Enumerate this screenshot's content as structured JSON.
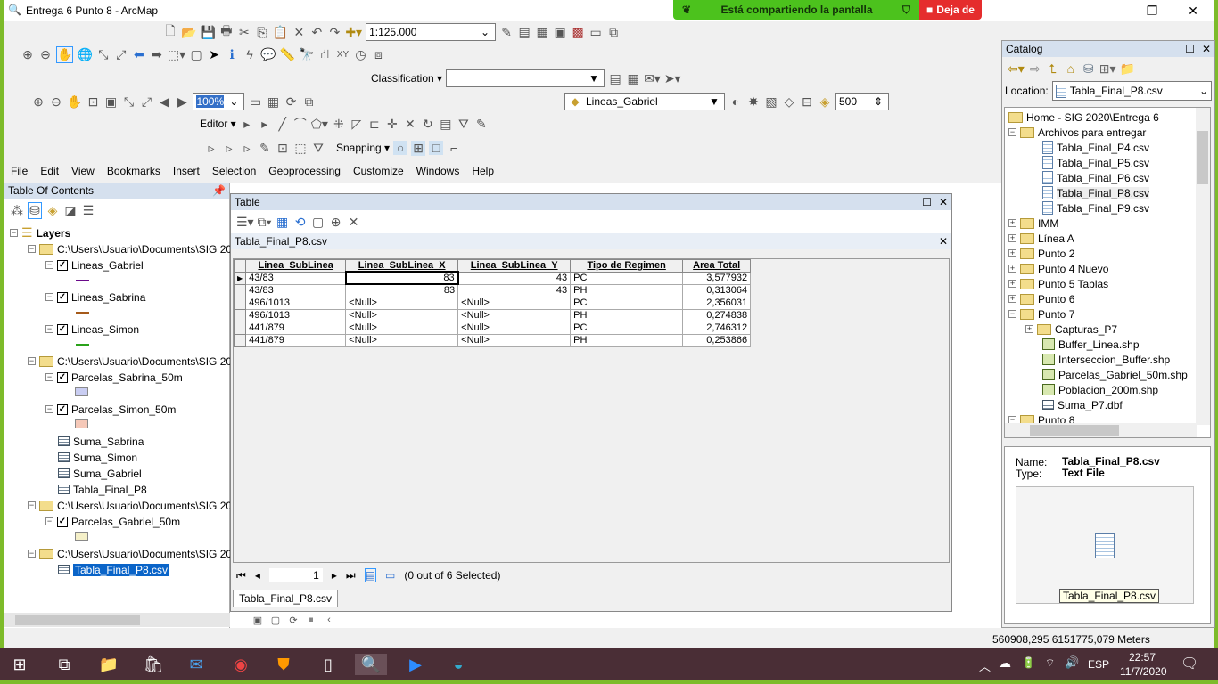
{
  "window": {
    "title": "Entrega 6 Punto 8 - ArcMap",
    "minimize": "–",
    "restore": "❐",
    "close": "✕"
  },
  "screenshare": {
    "text": "Está compartiendo la pantalla",
    "stop": "Deja de"
  },
  "toolbar": {
    "scale": "1:125.000",
    "classification": "Classification ▾",
    "zoom_pct": "100%",
    "layer": "Lineas_Gabriel",
    "ref_scale": "500",
    "editor": "Editor ▾",
    "snapping": "Snapping ▾"
  },
  "menu": [
    "File",
    "Edit",
    "View",
    "Bookmarks",
    "Insert",
    "Selection",
    "Geoprocessing",
    "Customize",
    "Windows",
    "Help"
  ],
  "toc": {
    "title": "Table Of Contents",
    "root": "Layers",
    "items": [
      {
        "type": "folder",
        "label": "C:\\Users\\Usuario\\Documents\\SIG 20"
      },
      {
        "type": "layer",
        "label": "Lineas_Gabriel",
        "color": "#6a0a8a",
        "sym": "line"
      },
      {
        "type": "layer",
        "label": "Lineas_Sabrina",
        "color": "#a55a1a",
        "sym": "line"
      },
      {
        "type": "layer",
        "label": "Lineas_Simon",
        "color": "#2aa21a",
        "sym": "line"
      },
      {
        "type": "folder",
        "label": "C:\\Users\\Usuario\\Documents\\SIG 20"
      },
      {
        "type": "layer",
        "label": "Parcelas_Sabrina_50m",
        "color": "#c9cdf2",
        "sym": "fill"
      },
      {
        "type": "layer",
        "label": "Parcelas_Simon_50m",
        "color": "#f5c8b8",
        "sym": "fill"
      },
      {
        "type": "table",
        "label": "Suma_Sabrina"
      },
      {
        "type": "table",
        "label": "Suma_Simon"
      },
      {
        "type": "table",
        "label": "Suma_Gabriel"
      },
      {
        "type": "table",
        "label": "Tabla_Final_P8"
      },
      {
        "type": "folder",
        "label": "C:\\Users\\Usuario\\Documents\\SIG 20"
      },
      {
        "type": "layer",
        "label": "Parcelas_Gabriel_50m",
        "color": "#f5f0c8",
        "sym": "fill"
      },
      {
        "type": "folder",
        "label": "C:\\Users\\Usuario\\Documents\\SIG 20"
      },
      {
        "type": "table",
        "label": "Tabla_Final_P8.csv",
        "selected": true
      }
    ]
  },
  "table": {
    "title": "Table",
    "tab_name": "Tabla_Final_P8.csv",
    "columns": [
      "Linea_SubLinea",
      "Linea_SubLinea_X",
      "Linea_SubLinea_Y",
      "Tipo de Regimen",
      "Area Total"
    ],
    "rows": [
      [
        "43/83",
        "83",
        "43",
        "PC",
        "3,577932"
      ],
      [
        "43/83",
        "83",
        "43",
        "PH",
        "0,313064"
      ],
      [
        "496/1013",
        "<Null>",
        "<Null>",
        "PC",
        "2,356031"
      ],
      [
        "496/1013",
        "<Null>",
        "<Null>",
        "PH",
        "0,274838"
      ],
      [
        "441/879",
        "<Null>",
        "<Null>",
        "PC",
        "2,746312"
      ],
      [
        "441/879",
        "<Null>",
        "<Null>",
        "PH",
        "0,253866"
      ]
    ],
    "record": "1",
    "selection": "(0 out of 6 Selected)",
    "bottom_tab": "Tabla_Final_P8.csv"
  },
  "catalog": {
    "title": "Catalog",
    "location_label": "Location:",
    "location": "Tabla_Final_P8.csv",
    "items": [
      {
        "d": 0,
        "icon": "home",
        "pm": "",
        "label": "Home - SIG 2020\\Entrega 6"
      },
      {
        "d": 0,
        "icon": "folder",
        "pm": "−",
        "label": "Archivos para entregar"
      },
      {
        "d": 1,
        "icon": "file",
        "pm": "",
        "label": "Tabla_Final_P4.csv"
      },
      {
        "d": 1,
        "icon": "file",
        "pm": "",
        "label": "Tabla_Final_P5.csv"
      },
      {
        "d": 1,
        "icon": "file",
        "pm": "",
        "label": "Tabla_Final_P6.csv"
      },
      {
        "d": 1,
        "icon": "file",
        "pm": "",
        "label": "Tabla_Final_P8.csv",
        "selected": true
      },
      {
        "d": 1,
        "icon": "file",
        "pm": "",
        "label": "Tabla_Final_P9.csv"
      },
      {
        "d": 0,
        "icon": "folder",
        "pm": "+",
        "label": "IMM"
      },
      {
        "d": 0,
        "icon": "folder",
        "pm": "+",
        "label": "Línea A"
      },
      {
        "d": 0,
        "icon": "folder",
        "pm": "+",
        "label": "Punto 2"
      },
      {
        "d": 0,
        "icon": "folder",
        "pm": "+",
        "label": "Punto 4 Nuevo"
      },
      {
        "d": 0,
        "icon": "folder",
        "pm": "+",
        "label": "Punto 5 Tablas"
      },
      {
        "d": 0,
        "icon": "folder",
        "pm": "+",
        "label": "Punto 6"
      },
      {
        "d": 0,
        "icon": "folder",
        "pm": "−",
        "label": "Punto 7"
      },
      {
        "d": 1,
        "icon": "folder",
        "pm": "+",
        "label": "Capturas_P7"
      },
      {
        "d": 1,
        "icon": "shp",
        "pm": "",
        "label": "Buffer_Linea.shp"
      },
      {
        "d": 1,
        "icon": "shp",
        "pm": "",
        "label": "Interseccion_Buffer.shp"
      },
      {
        "d": 1,
        "icon": "shp",
        "pm": "",
        "label": "Parcelas_Gabriel_50m.shp"
      },
      {
        "d": 1,
        "icon": "shp",
        "pm": "",
        "label": "Poblacion_200m.shp"
      },
      {
        "d": 1,
        "icon": "table",
        "pm": "",
        "label": "Suma_P7.dbf"
      },
      {
        "d": 0,
        "icon": "folder",
        "pm": "−",
        "label": "Punto 8"
      }
    ],
    "name_label": "Name:",
    "name": "Tabla_Final_P8.csv",
    "type_label": "Type:",
    "type": "Text File",
    "preview": "Tabla_Final_P8.csv"
  },
  "status": {
    "coords": "560908,295  6151775,079 Meters"
  },
  "taskbar": {
    "lang": "ESP",
    "time": "22:57",
    "date": "11/7/2020"
  }
}
